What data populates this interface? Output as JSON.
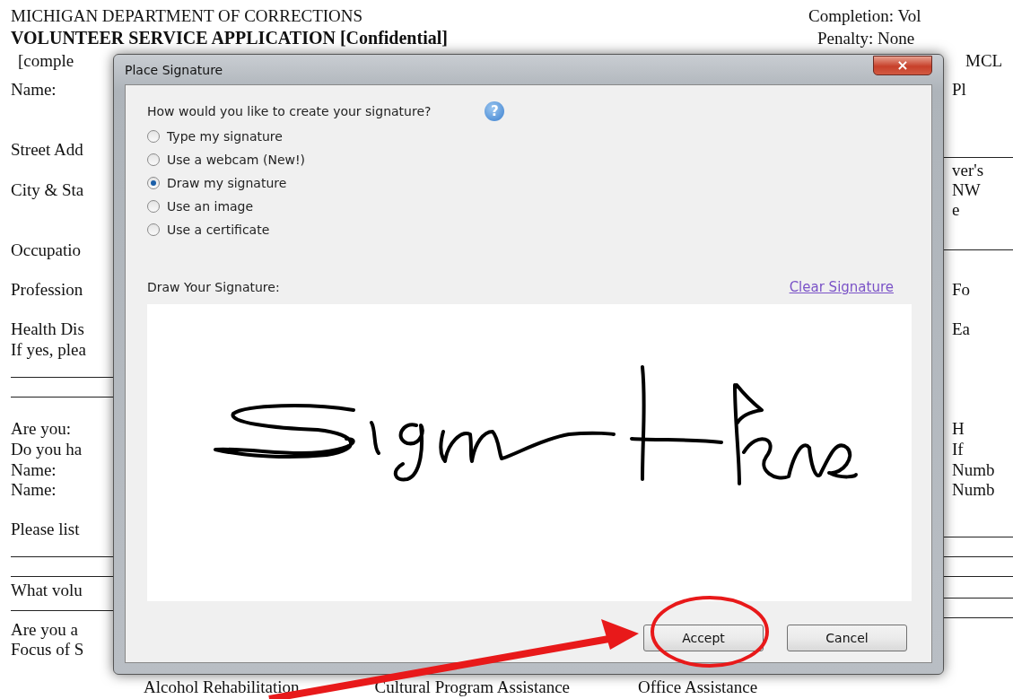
{
  "document": {
    "header_left": [
      "MICHIGAN DEPARTMENT OF CORRECTIONS",
      "VOLUNTEER SERVICE APPLICATION [Confidential]",
      "[comple"
    ],
    "header_right": [
      "Completion: Vol",
      "Penalty: None",
      "MCL"
    ],
    "left_column": [
      {
        "kind": "text",
        "text": "Name:"
      },
      {
        "kind": "text",
        "text": "Street Add"
      },
      {
        "kind": "text",
        "text": "City & Sta"
      },
      {
        "kind": "text",
        "text": "Occupatio"
      },
      {
        "kind": "text",
        "text": "Profession"
      },
      {
        "kind": "text",
        "text": "Health Dis"
      },
      {
        "kind": "text",
        "text": "If yes, plea"
      },
      {
        "kind": "rule"
      },
      {
        "kind": "rule"
      },
      {
        "kind": "text",
        "text": "Are you:"
      },
      {
        "kind": "text",
        "text": "Do you ha"
      },
      {
        "kind": "text",
        "text": "Name:"
      },
      {
        "kind": "text",
        "text": "Name:"
      },
      {
        "kind": "text",
        "text": "Please list"
      },
      {
        "kind": "rule"
      },
      {
        "kind": "rule"
      },
      {
        "kind": "text",
        "text": "What volu"
      },
      {
        "kind": "rule"
      },
      {
        "kind": "text",
        "text": "Are you a"
      },
      {
        "kind": "text",
        "text": "Focus of S"
      }
    ],
    "right_column": [
      {
        "kind": "text",
        "text": "Pl"
      },
      {
        "kind": "rule"
      },
      {
        "kind": "text",
        "text": "ver's"
      },
      {
        "kind": "text",
        "text": "NW"
      },
      {
        "kind": "text",
        "text": "e"
      },
      {
        "kind": "rule"
      },
      {
        "kind": "text",
        "text": "Fo"
      },
      {
        "kind": "text",
        "text": "Ea"
      },
      {
        "kind": "text",
        "text": "H"
      },
      {
        "kind": "text",
        "text": "If"
      },
      {
        "kind": "text",
        "text": "Numb"
      },
      {
        "kind": "text",
        "text": "Numb"
      },
      {
        "kind": "rule"
      },
      {
        "kind": "rule"
      },
      {
        "kind": "rule"
      },
      {
        "kind": "rule"
      },
      {
        "kind": "rule"
      }
    ],
    "bottom_row": [
      "Alcohol Rehabilitation",
      "Cultural Program Assistance",
      "Office Assistance"
    ]
  },
  "dialog": {
    "title": "Place Signature",
    "close": "×",
    "question": "How would you like to create your signature?",
    "help": "?",
    "options": [
      {
        "label": "Type my signature",
        "selected": false
      },
      {
        "label": "Use a webcam (New!)",
        "selected": false
      },
      {
        "label": "Draw my signature",
        "selected": true
      },
      {
        "label": "Use an image",
        "selected": false
      },
      {
        "label": "Use a certificate",
        "selected": false
      }
    ],
    "draw_label": "Draw Your Signature:",
    "clear_link": "Clear Signature",
    "buttons": [
      "Accept",
      "Cancel"
    ]
  }
}
